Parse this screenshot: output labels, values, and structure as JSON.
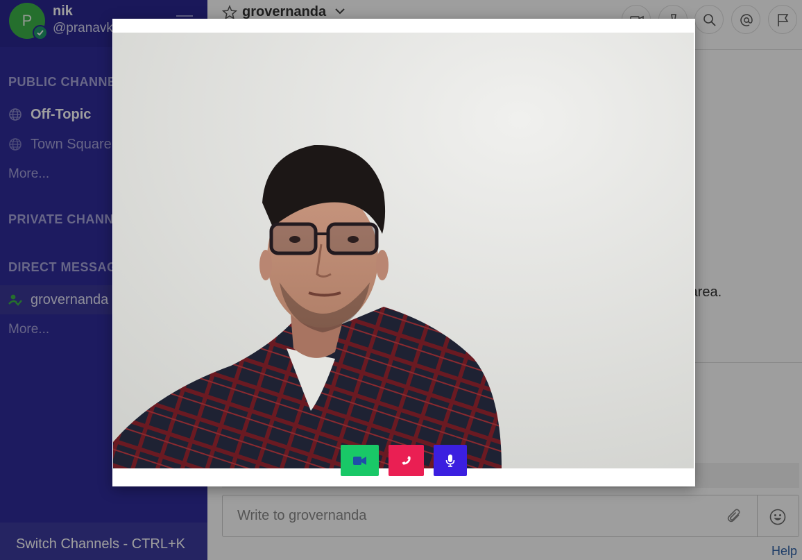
{
  "user": {
    "avatar_initial": "P",
    "name": "nik",
    "handle": "@pranavkrgrover"
  },
  "sidebar": {
    "public_title": "PUBLIC CHANNELS",
    "public_channels": [
      {
        "label": "Off-Topic",
        "icon": "globe-icon"
      },
      {
        "label": "Town Square",
        "icon": "globe-icon"
      }
    ],
    "public_more": "More...",
    "private_title": "PRIVATE CHANNELS",
    "dm_title": "DIRECT MESSAGES",
    "direct_messages": [
      {
        "label": "grovernanda",
        "icon": "online-status-icon"
      }
    ],
    "dm_more": "More...",
    "switch_channels": "Switch Channels - CTRL+K"
  },
  "header": {
    "channel_name": "grovernanda"
  },
  "main": {
    "message_hint": "s area."
  },
  "composer": {
    "placeholder": "Write to grovernanda"
  },
  "help": "Help",
  "call": {
    "controls": [
      {
        "name": "video-toggle",
        "icon": "video-camera-icon",
        "color": "#19c867"
      },
      {
        "name": "hang-up",
        "icon": "phone-icon",
        "color": "#ea1f53"
      },
      {
        "name": "mic-toggle",
        "icon": "microphone-icon",
        "color": "#3b1fe0"
      }
    ]
  },
  "colors": {
    "sidebar": "#2f2c9b",
    "accent_green": "#3db34a",
    "link": "#2f62a7"
  }
}
